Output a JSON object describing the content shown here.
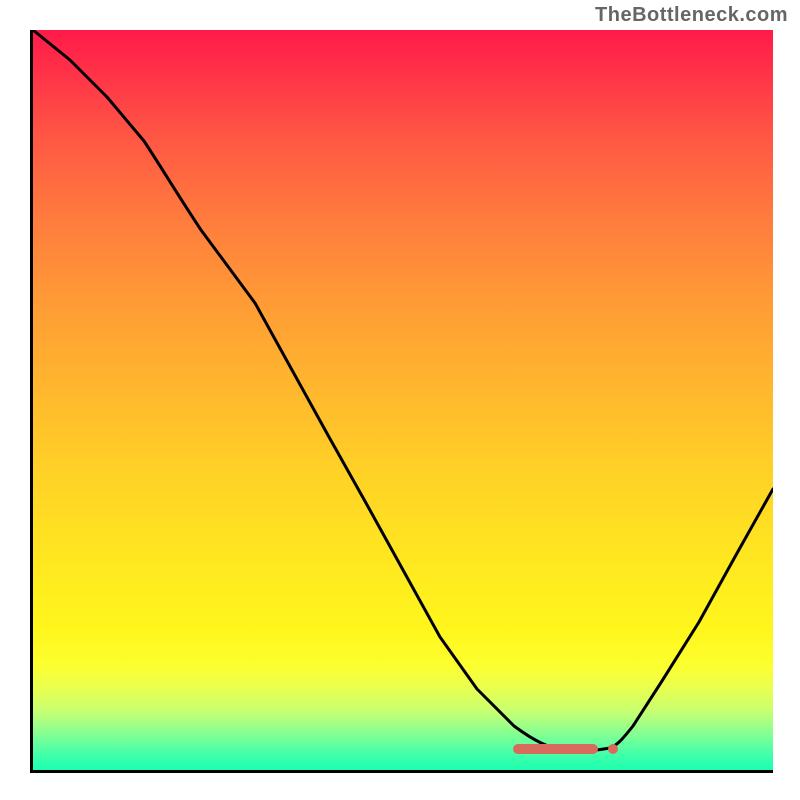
{
  "attribution": "TheBottleneck.com",
  "chart_data": {
    "type": "line",
    "title": "",
    "xlabel": "",
    "ylabel": "",
    "xlim": [
      0,
      100
    ],
    "ylim": [
      0,
      100
    ],
    "series": [
      {
        "name": "bottleneck-curve",
        "x": [
          0,
          5,
          10,
          15,
          20,
          25,
          30,
          35,
          40,
          45,
          50,
          55,
          60,
          65,
          70,
          72,
          75,
          78,
          80,
          85,
          90,
          95,
          100
        ],
        "y": [
          100,
          96,
          91,
          85,
          78,
          72,
          63,
          54,
          45,
          36,
          27,
          18,
          11,
          6,
          3,
          2.5,
          2.5,
          3,
          6,
          12,
          20,
          29,
          38
        ]
      }
    ],
    "markers": [
      {
        "name": "optimal-range",
        "x_start": 65,
        "x_end": 77,
        "y": 2.5
      },
      {
        "name": "optimal-point",
        "x": 78,
        "y": 2.5
      }
    ],
    "background": {
      "gradient_stops": [
        {
          "pos": 0.0,
          "color": "#ff1a4a"
        },
        {
          "pos": 0.5,
          "color": "#ffb62e"
        },
        {
          "pos": 0.85,
          "color": "#fff61c"
        },
        {
          "pos": 1.0,
          "color": "#1affb0"
        }
      ]
    }
  }
}
